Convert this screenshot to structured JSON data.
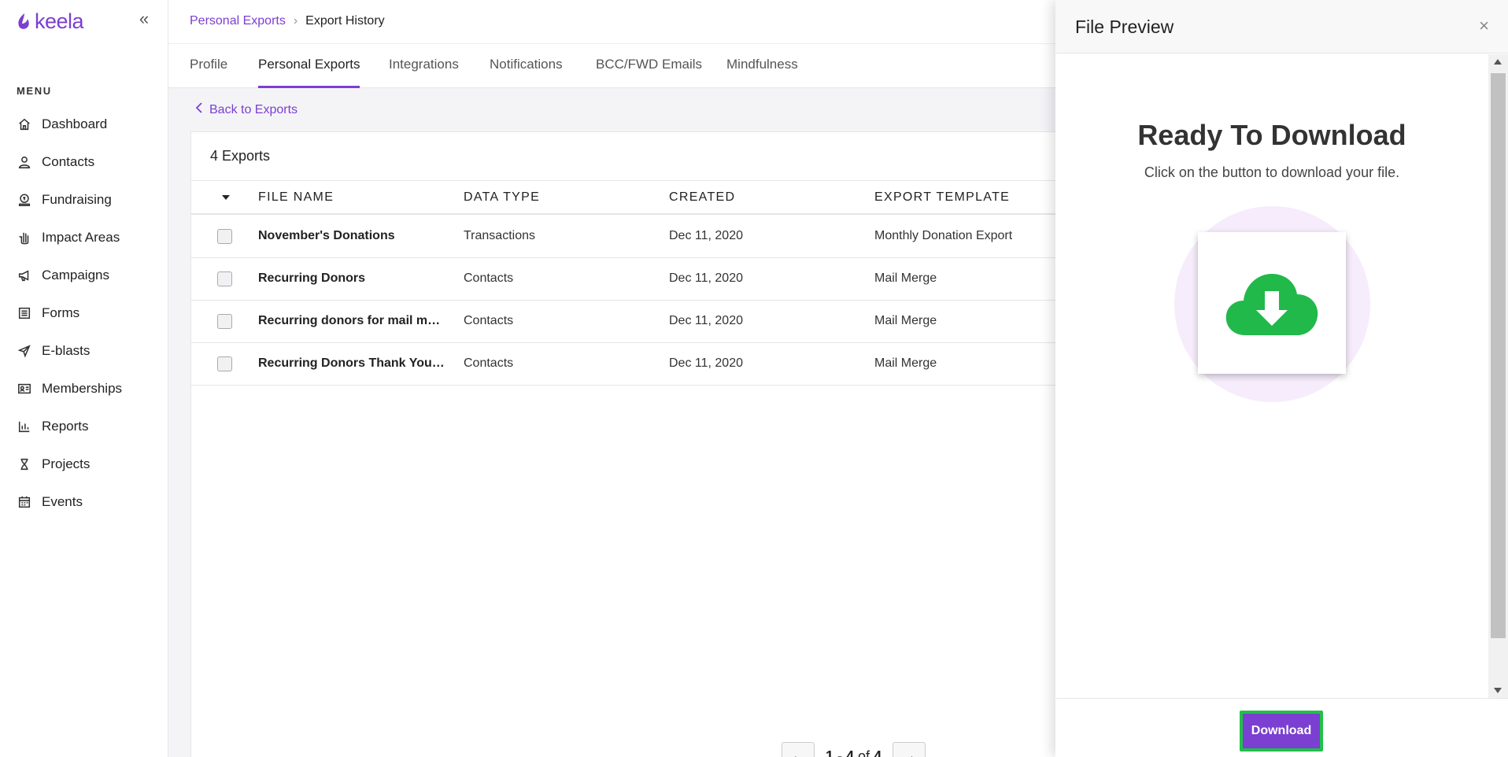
{
  "app": {
    "logo_text": "keela",
    "brand_color": "#7b3fd1",
    "highlight_color": "#21c04a"
  },
  "sidebar": {
    "menu_label": "MENU",
    "items": [
      {
        "label": "Dashboard",
        "icon": "home-icon"
      },
      {
        "label": "Contacts",
        "icon": "user-icon"
      },
      {
        "label": "Fundraising",
        "icon": "donation-icon"
      },
      {
        "label": "Impact Areas",
        "icon": "hand-icon"
      },
      {
        "label": "Campaigns",
        "icon": "megaphone-icon"
      },
      {
        "label": "Forms",
        "icon": "list-icon"
      },
      {
        "label": "E-blasts",
        "icon": "paper-plane-icon"
      },
      {
        "label": "Memberships",
        "icon": "id-card-icon"
      },
      {
        "label": "Reports",
        "icon": "bar-chart-icon"
      },
      {
        "label": "Projects",
        "icon": "hourglass-icon"
      },
      {
        "label": "Events",
        "icon": "calendar-icon"
      }
    ]
  },
  "breadcrumb": {
    "parent": "Personal Exports",
    "current": "Export History"
  },
  "tabs": [
    "Profile",
    "Personal Exports",
    "Integrations",
    "Notifications",
    "BCC/FWD Emails",
    "Mindfulness"
  ],
  "active_tab": "Personal Exports",
  "back_link": "Back to Exports",
  "exports": {
    "title": "4 Exports",
    "columns": [
      "FILE NAME",
      "DATA TYPE",
      "CREATED",
      "EXPORT TEMPLATE"
    ],
    "rows": [
      [
        "November's Donations",
        "Transactions",
        "Dec 11, 2020",
        "Monthly Donation Export"
      ],
      [
        "Recurring Donors",
        "Contacts",
        "Dec 11, 2020",
        "Mail Merge"
      ],
      [
        "Recurring donors for mail merge",
        "Contacts",
        "Dec 11, 2020",
        "Mail Merge"
      ],
      [
        "Recurring Donors Thank You Letters",
        "Contacts",
        "Dec 11, 2020",
        "Mail Merge"
      ]
    ]
  },
  "pagination": {
    "range": "1 - 4",
    "of_label": "of",
    "total": "4"
  },
  "panel": {
    "title": "File Preview",
    "close": "×",
    "heading": "Ready To Download",
    "subheading": "Click on the button to download your file.",
    "download_label": "Download",
    "illustration_icon": "cloud-download-icon"
  }
}
